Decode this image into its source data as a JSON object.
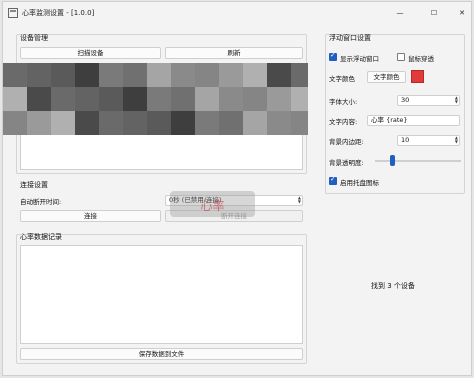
{
  "window": {
    "title": "心率监测设置 - [1.0.0]",
    "controls": {
      "minimize": "—",
      "maximize": "☐",
      "close": "✕"
    }
  },
  "device_group": {
    "title": "设备管理",
    "scan_button": "扫描设备",
    "refresh_button": "刷新"
  },
  "connection_group": {
    "title": "连接设置",
    "auto_reconnect_label": "自动断开时间:",
    "auto_reconnect_value": "0秒 (已禁用/连接)",
    "connect_button": "连接",
    "disconnect_button": "断开连接"
  },
  "log_group": {
    "title": "心率数据记录",
    "save_button": "保存数据到文件"
  },
  "float_group": {
    "title": "浮动窗口设置",
    "show_float_label": "显示浮动窗口",
    "show_float_checked": true,
    "mouse_through_label": "鼠标穿透",
    "mouse_through_checked": false,
    "text_color_label": "文字颜色",
    "text_color_button": "文字颜色",
    "text_color_swatch": "#e03a3a",
    "font_size_label": "字体大小:",
    "font_size_value": "30",
    "text_content_label": "文字内容:",
    "text_content_value": "心率 {rate}",
    "padding_label": "背景内边距:",
    "padding_value": "10",
    "opacity_label": "背景透明度:",
    "opacity_value": 0.2,
    "tray_icon_label": "启用托盘图标",
    "tray_icon_checked": true
  },
  "status": {
    "found_devices": "找到 3 个设备"
  },
  "overlay": {
    "text": "心率"
  },
  "colors": {
    "accent": "#1f5fbf",
    "window_bg": "#f3f3f3"
  }
}
